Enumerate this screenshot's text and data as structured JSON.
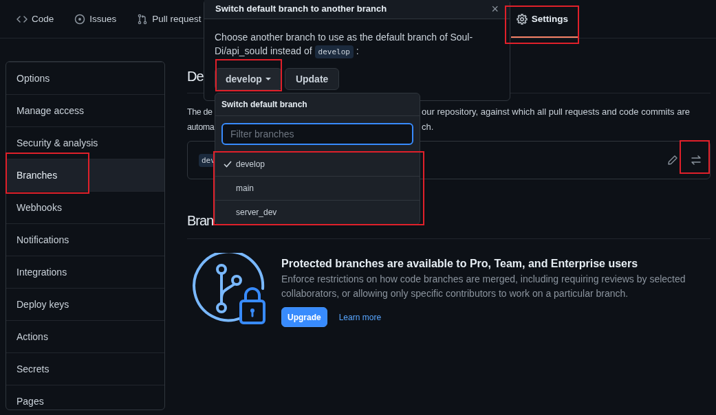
{
  "nav": {
    "tabs": [
      {
        "label": "Code",
        "selected": false
      },
      {
        "label": "Issues",
        "selected": false
      },
      {
        "label": "Pull request",
        "selected": false
      },
      {
        "label": "Settings",
        "selected": true
      }
    ]
  },
  "sidebar": {
    "items": [
      {
        "label": "Options",
        "selected": false
      },
      {
        "label": "Manage access",
        "selected": false
      },
      {
        "label": "Security & analysis",
        "selected": false
      },
      {
        "label": "Branches",
        "selected": true
      },
      {
        "label": "Webhooks",
        "selected": false
      },
      {
        "label": "Notifications",
        "selected": false
      },
      {
        "label": "Integrations",
        "selected": false
      },
      {
        "label": "Deploy keys",
        "selected": false
      },
      {
        "label": "Actions",
        "selected": false
      },
      {
        "label": "Secrets",
        "selected": false
      },
      {
        "label": "Pages",
        "selected": false
      }
    ]
  },
  "main": {
    "heading_1": "De",
    "description": {
      "line_1_start": "The de",
      "line_1_end": "our repository, against which all pull requests and code commits are",
      "line_2_start": "automa",
      "line_2_end": "ch."
    },
    "default_branch": {
      "chip": "dev"
    },
    "heading_2": "Bran",
    "upsell": {
      "title": "Protected branches are available to Pro, Team, and Enterprise users",
      "description": "Enforce restrictions on how code branches are merged, including requiring reviews by selected collaborators, or allowing only specific contributors to work on a particular branch.",
      "button": "Upgrade",
      "link": "Learn more"
    }
  },
  "dialog": {
    "title": "Switch default branch to another branch",
    "close": "×",
    "message": {
      "before": "Choose another branch to use as the default branch of Soul-Di/api_sould instead of ",
      "code": "develop",
      "after": ":"
    },
    "branch_button": "develop",
    "update_button": "Update"
  },
  "dropdown": {
    "title": "Switch default branch",
    "filter": {
      "placeholder": "Filter branches"
    },
    "branches": [
      {
        "name": "develop",
        "selected": true
      },
      {
        "name": "main",
        "selected": false
      },
      {
        "name": "server_dev",
        "selected": false
      }
    ]
  }
}
